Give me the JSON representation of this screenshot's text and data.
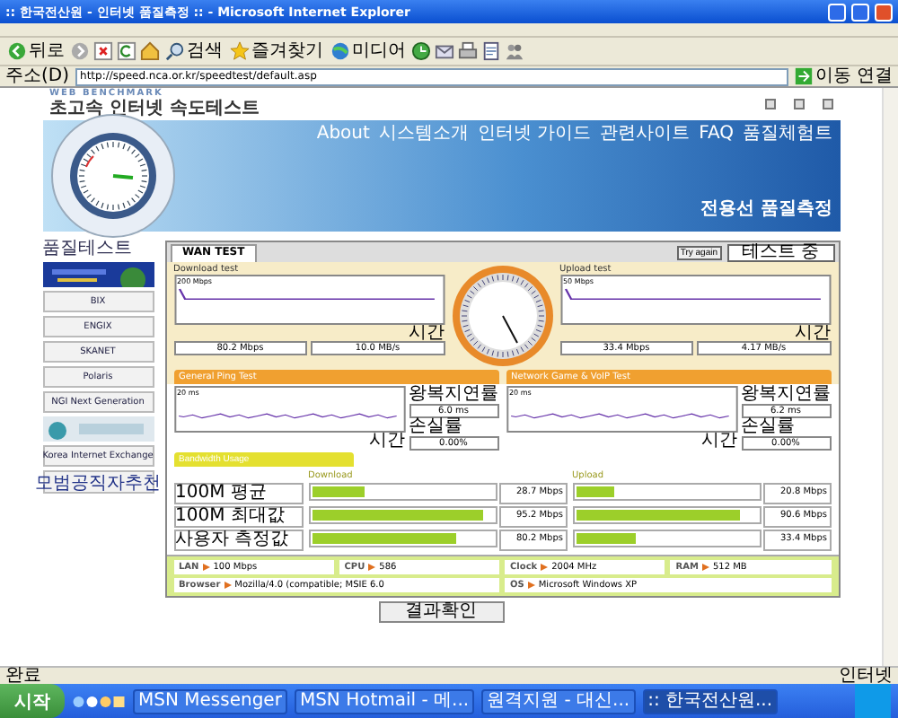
{
  "window": {
    "title": ":: 한국전산원 - 인터넷 품질측정 :: - Microsoft Internet Explorer"
  },
  "toolbar": [
    {
      "kind": "back",
      "label": "뒤로"
    },
    {
      "kind": "forward"
    },
    {
      "kind": "stop"
    },
    {
      "kind": "refresh"
    },
    {
      "kind": "home"
    },
    {
      "kind": "search",
      "label": "검색"
    },
    {
      "kind": "favorites",
      "label": "즐겨찾기"
    },
    {
      "kind": "media",
      "label": "미디어"
    },
    {
      "kind": "history"
    },
    {
      "kind": "mail"
    },
    {
      "kind": "print"
    },
    {
      "kind": "edit"
    },
    {
      "kind": "messenger"
    }
  ],
  "address_bar": {
    "label": "주소(D)",
    "url": "http://speed.nca.or.kr/speedtest/default.asp",
    "go": "이동",
    "links": "연결"
  },
  "page": {
    "brand": "WEB BENCHMARK",
    "site_title": "초고속 인터넷 속도테스트",
    "nav": [
      "About",
      "시스템소개",
      "인터넷 가이드",
      "관련사이트",
      "FAQ",
      "품질체험트"
    ],
    "banner_title": "전용선 품질측정",
    "sidebar": {
      "heading": "품질테스트",
      "logos": [
        {
          "kind": "picture"
        },
        {
          "kind": "logo",
          "label": "BIX"
        },
        {
          "kind": "logo",
          "label": "ENGIX"
        },
        {
          "kind": "logo",
          "label": "SKANET"
        },
        {
          "kind": "logo",
          "label": "Polaris"
        },
        {
          "kind": "logo",
          "label": "NGI Next Generation"
        },
        {
          "kind": "picture"
        },
        {
          "kind": "logo",
          "label": "Korea Internet Exchange"
        },
        {
          "kind": "logo",
          "label": "모범공직자추천"
        }
      ]
    },
    "test": {
      "tab": "WAN TEST",
      "try_again": "Try again",
      "state": "테스트 중",
      "download": {
        "title": "Download test",
        "scale": "200 Mbps",
        "axis": "시간",
        "mbps": "80.2 Mbps",
        "mbs": "10.0 MB/s"
      },
      "upload": {
        "title": "Upload test",
        "scale": "50 Mbps",
        "axis": "시간",
        "mbps": "33.4 Mbps",
        "mbs": "4.17 MB/s"
      },
      "ping_buttons": [
        "General Ping Test",
        "Network Game & VoIP Test"
      ],
      "ping": [
        {
          "scale": "20 ms",
          "axis": "시간",
          "delay_label": "왕복지연률",
          "delay": "6.0 ms",
          "loss_label": "손실률",
          "loss": "0.00%"
        },
        {
          "scale": "20 ms",
          "axis": "시간",
          "delay_label": "왕복지연률",
          "delay": "6.2 ms",
          "loss_label": "손실률",
          "loss": "0.00%"
        }
      ],
      "usage_button": "Bandwidth Usage",
      "table": {
        "columns": [
          "Download",
          "Upload"
        ],
        "rows": [
          {
            "label": "100M 평균",
            "download": {
              "level": 0.29,
              "value": "28.7 Mbps"
            },
            "upload": {
              "level": 0.21,
              "value": "20.8 Mbps"
            }
          },
          {
            "label": "100M 최대값",
            "download": {
              "level": 0.95,
              "value": "95.2 Mbps"
            },
            "upload": {
              "level": 0.91,
              "value": "90.6 Mbps"
            }
          },
          {
            "label": "사용자 측정값",
            "download": {
              "level": 0.8,
              "value": "80.2 Mbps"
            },
            "upload": {
              "level": 0.33,
              "value": "33.4 Mbps"
            }
          }
        ]
      },
      "system": [
        [
          {
            "key": "LAN",
            "value": "100 Mbps"
          },
          {
            "key": "CPU",
            "value": "586"
          },
          {
            "key": "Clock",
            "value": "2004 MHz"
          },
          {
            "key": "RAM",
            "value": "512 MB"
          }
        ],
        [
          {
            "key": "Browser",
            "value": "Mozilla/4.0 (compatible; MSIE 6.0"
          },
          {
            "key": "OS",
            "value": "Microsoft Windows XP"
          }
        ]
      ],
      "result_button": "결과확인"
    }
  },
  "status_bar": {
    "text": "완료",
    "zone": "인터넷"
  },
  "taskbar": {
    "start": "시작",
    "tasks": [
      {
        "label": "MSN Messenger",
        "selected": false
      },
      {
        "label": "MSN Hotmail - 메...",
        "selected": false
      },
      {
        "label": "원격지원 - 대신...",
        "selected": false
      },
      {
        "label": ":: 한국전산원...",
        "selected": true
      }
    ]
  }
}
